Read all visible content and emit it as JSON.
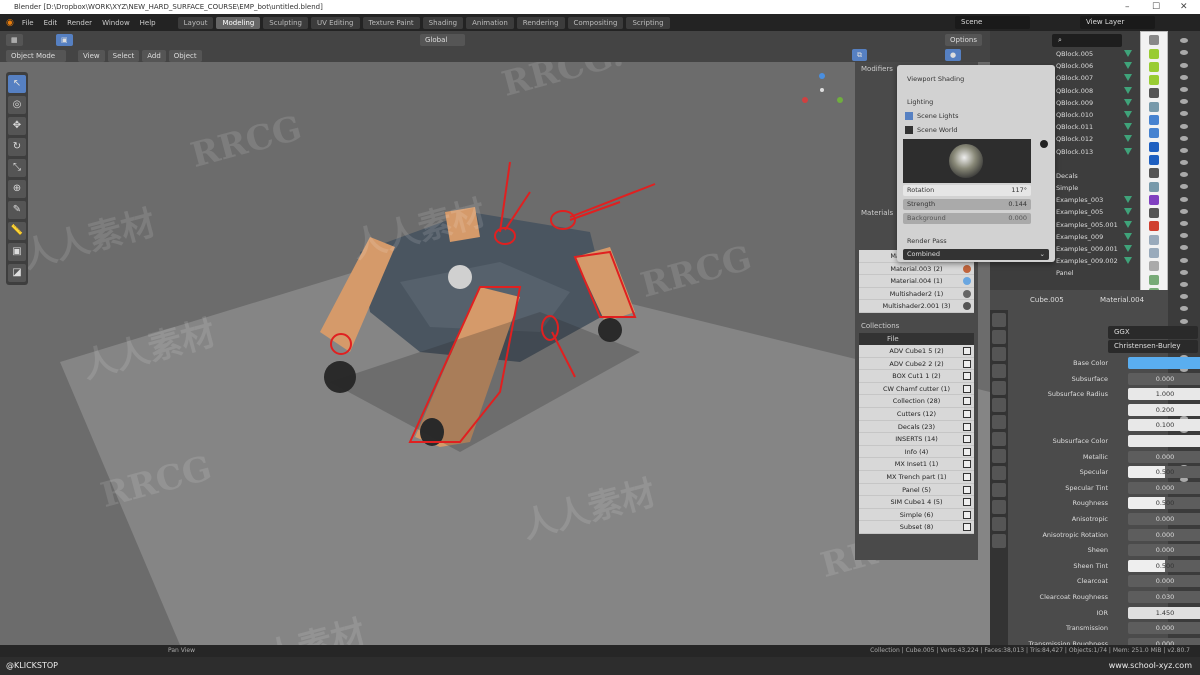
{
  "window": {
    "title": "Blender [D:\\Dropbox\\WORK\\XYZ\\NEW_HARD_SURFACE_COURSE\\EMP_bot\\untitled.blend]",
    "minimize": "–",
    "maximize": "☐",
    "close": "✕"
  },
  "menu": [
    "File",
    "Edit",
    "Render",
    "Window",
    "Help"
  ],
  "workspaces": [
    "Layout",
    "Modeling",
    "Sculpting",
    "UV Editing",
    "Texture Paint",
    "Shading",
    "Animation",
    "Rendering",
    "Compositing",
    "Scripting"
  ],
  "active_workspace": "Modeling",
  "scene": "Scene",
  "view_layer": "View Layer",
  "viewport_header": {
    "transform": "Global",
    "options": "Options",
    "mode": "Object Mode",
    "menus": [
      "View",
      "Select",
      "Add",
      "Object"
    ]
  },
  "shading_popover": {
    "title": "Viewport Shading",
    "lighting": "Lighting",
    "scene_lights": "Scene Lights",
    "scene_lights_checked": true,
    "scene_world": "Scene World",
    "scene_world_checked": false,
    "rotation_label": "Rotation",
    "rotation": "117°",
    "strength_label": "Strength",
    "strength": "0.144",
    "background_label": "Background",
    "background": "0.000",
    "render_pass_label": "Render Pass",
    "render_pass": "Combined"
  },
  "npanel": {
    "modifiers_header": "Modifiers",
    "materials_header": "Materials",
    "materials": [
      {
        "name": "Material.002 (1)",
        "color": "#777788"
      },
      {
        "name": "Material.003 (2)",
        "color": "#c0643c"
      },
      {
        "name": "Material.004 (1)",
        "color": "#6aa6e0"
      },
      {
        "name": "Multishader2 (1)",
        "color": "#666"
      },
      {
        "name": "Multishader2.001 (3)",
        "color": "#555"
      }
    ],
    "collections_header": "Collections",
    "filter": "File",
    "collections": [
      "ADV Cube1 5 (2)",
      "ADV Cube2 2 (2)",
      "BOX Cut1 1 (2)",
      "CW Chamf cutter (1)",
      "Collection (28)",
      "Cutters (12)",
      "Decals (23)",
      "INSERTS (14)",
      "Info (4)",
      "MX Inset1 (1)",
      "MX Trench part (1)",
      "Panel (5)",
      "SIM Cube1 4 (5)",
      "Simple (6)",
      "Subset (8)"
    ]
  },
  "outliner": {
    "items": [
      "QBlock.005",
      "QBlock.006",
      "QBlock.007",
      "QBlock.008",
      "QBlock.009",
      "QBlock.010",
      "QBlock.011",
      "QBlock.012",
      "QBlock.013",
      "",
      "Decals",
      "Simple",
      "Examples_003",
      "Examples_005",
      "Examples_005.001",
      "Examples_009",
      "Examples_009.001",
      "Examples_009.002",
      "Panel"
    ]
  },
  "properties": {
    "object": "Cube.005",
    "material": "Material.004",
    "distribution": "GGX",
    "subsurface_method": "Christensen-Burley",
    "base_color": "#5aaef0",
    "rows": [
      {
        "label": "Base Color",
        "value": ""
      },
      {
        "label": "Subsurface",
        "value": "0.000"
      },
      {
        "label": "Subsurface Radius",
        "value": "1.000"
      },
      {
        "label": "",
        "value": "0.200"
      },
      {
        "label": "",
        "value": "0.100"
      },
      {
        "label": "Subsurface Color",
        "value": ""
      },
      {
        "label": "Metallic",
        "value": "0.000"
      },
      {
        "label": "Specular",
        "value": "0.500"
      },
      {
        "label": "Specular Tint",
        "value": "0.000"
      },
      {
        "label": "Roughness",
        "value": "0.500"
      },
      {
        "label": "Anisotropic",
        "value": "0.000"
      },
      {
        "label": "Anisotropic Rotation",
        "value": "0.000"
      },
      {
        "label": "Sheen",
        "value": "0.000"
      },
      {
        "label": "Sheen Tint",
        "value": "0.500"
      },
      {
        "label": "Clearcoat",
        "value": "0.000"
      },
      {
        "label": "Clearcoat Roughness",
        "value": "0.030"
      },
      {
        "label": "IOR",
        "value": "1.450"
      },
      {
        "label": "Transmission",
        "value": "0.000"
      },
      {
        "label": "Transmission Roughness",
        "value": "0.000"
      }
    ]
  },
  "status": {
    "left": "Pan View",
    "right": "Collection | Cube.005 | Verts:43,224 | Faces:38,013 | Tris:84,427 | Objects:1/74 | Mem: 251.0 MiB | v2.80.7"
  },
  "bottom": {
    "left": "@KLICKSTOP",
    "right": "www.school-xyz.com"
  },
  "watermarks": [
    "RRCG",
    "人人素材",
    "RRCG.CN"
  ]
}
